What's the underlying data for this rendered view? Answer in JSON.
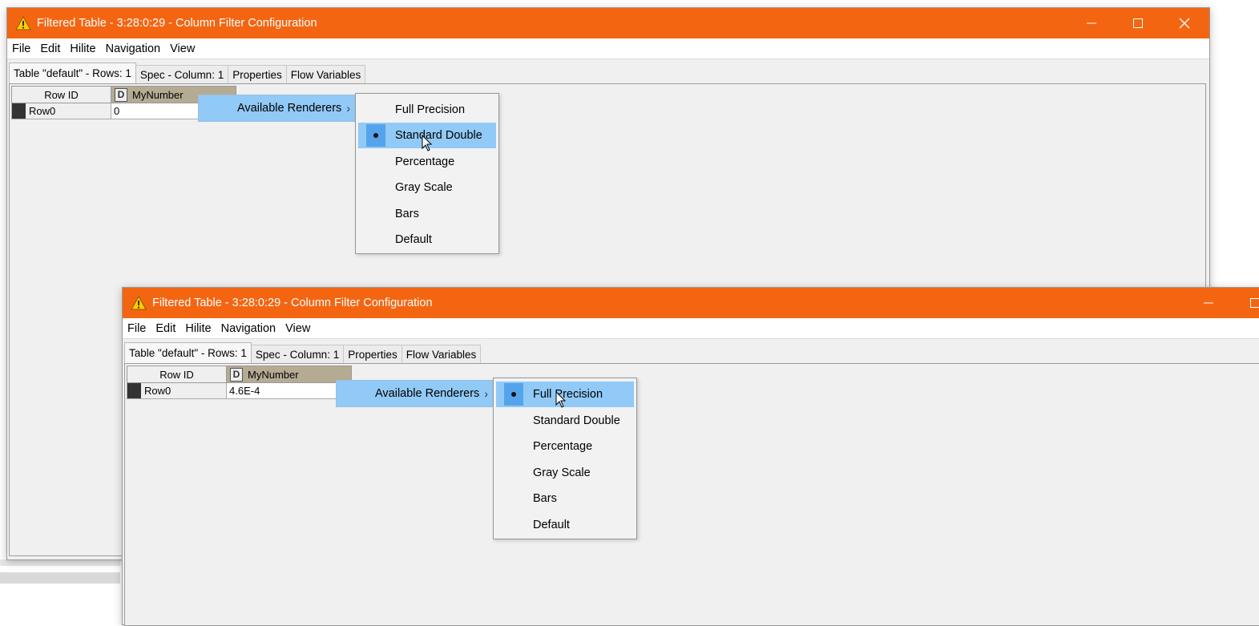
{
  "colors": {
    "titlebar": "#f46512",
    "highlight": "#91c9f7",
    "radio_selected": "#55a3ea",
    "column_header": "#b5ab93"
  },
  "window_back": {
    "title": "Filtered Table - 3:28:0:29 - Column Filter Configuration",
    "menu": [
      "File",
      "Edit",
      "Hilite",
      "Navigation",
      "View"
    ],
    "tabs": [
      "Table \"default\" - Rows: 1",
      "Spec - Column: 1",
      "Properties",
      "Flow Variables"
    ],
    "table": {
      "row_id_header": "Row ID",
      "column_type": "D",
      "column_name": "MyNumber",
      "rows": [
        {
          "id": "Row0",
          "value": "0"
        }
      ]
    },
    "context_menu": {
      "trigger_label": "Available Renderers",
      "items": [
        "Full Precision",
        "Standard Double",
        "Percentage",
        "Gray Scale",
        "Bars",
        "Default"
      ],
      "selected": "Standard Double"
    }
  },
  "window_front": {
    "title": "Filtered Table - 3:28:0:29 - Column Filter Configuration",
    "menu": [
      "File",
      "Edit",
      "Hilite",
      "Navigation",
      "View"
    ],
    "tabs": [
      "Table \"default\" - Rows: 1",
      "Spec - Column: 1",
      "Properties",
      "Flow Variables"
    ],
    "table": {
      "row_id_header": "Row ID",
      "column_type": "D",
      "column_name": "MyNumber",
      "rows": [
        {
          "id": "Row0",
          "value": "4.6E-4"
        }
      ]
    },
    "context_menu": {
      "trigger_label": "Available Renderers",
      "items": [
        "Full Precision",
        "Standard Double",
        "Percentage",
        "Gray Scale",
        "Bars",
        "Default"
      ],
      "selected": "Full Precision"
    }
  }
}
